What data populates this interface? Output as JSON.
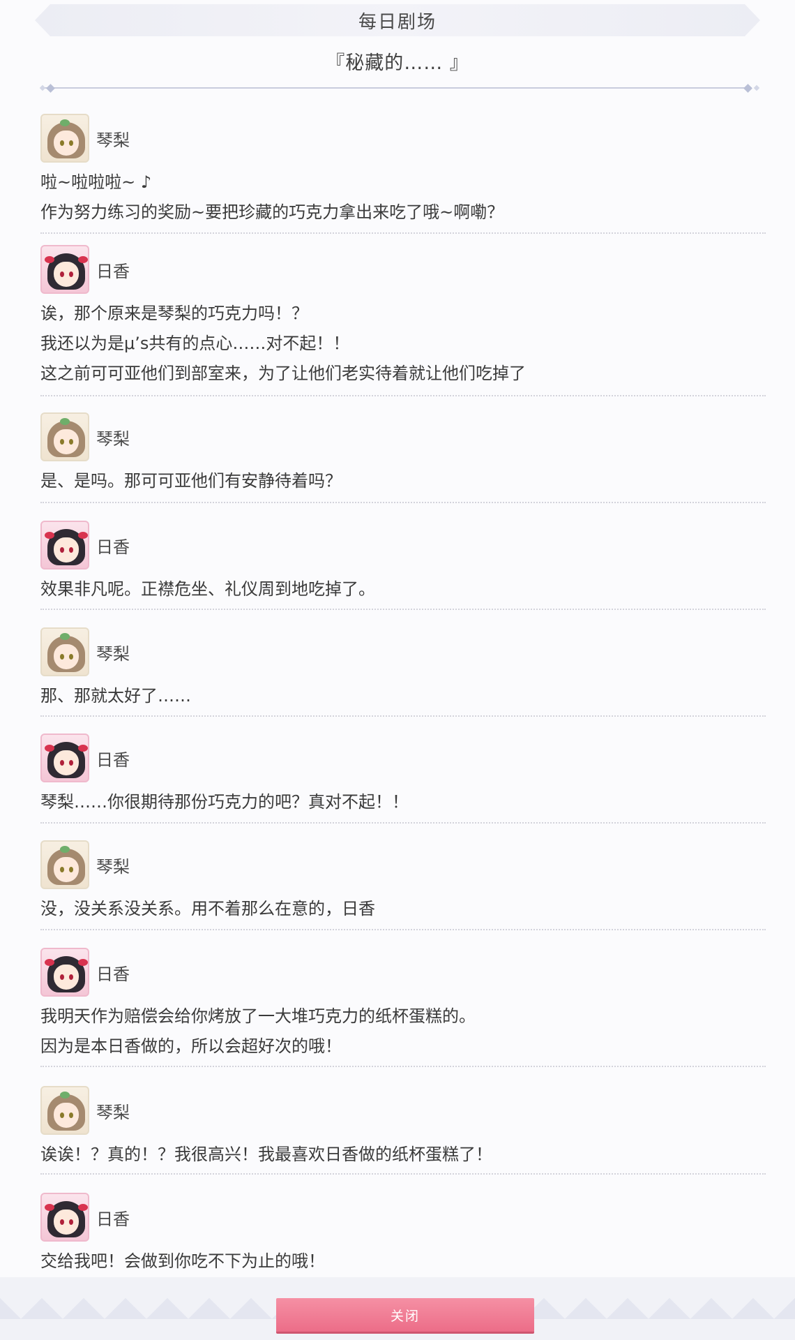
{
  "header": {
    "title": "每日剧场",
    "subtitle": "『秘藏的…… 』"
  },
  "dialogue": [
    {
      "speaker": "琴梨",
      "avatar": "kotori-avatar",
      "lines": [
        "啦~啦啦啦~ ♪",
        "作为努力练习的奖励~要把珍藏的巧克力拿出来吃了哦~啊嘞？"
      ]
    },
    {
      "speaker": "日香",
      "avatar": "nico-avatar",
      "lines": [
        "诶，那个原来是琴梨的巧克力吗！？",
        "我还以为是μ’s共有的点心……对不起！！",
        "这之前可可亚他们到部室来，为了让他们老实待着就让他们吃掉了"
      ]
    },
    {
      "speaker": "琴梨",
      "avatar": "kotori-avatar",
      "lines": [
        "是、是吗。那可可亚他们有安静待着吗？"
      ]
    },
    {
      "speaker": "日香",
      "avatar": "nico-avatar",
      "lines": [
        "效果非凡呢。正襟危坐、礼仪周到地吃掉了。"
      ]
    },
    {
      "speaker": "琴梨",
      "avatar": "kotori-avatar",
      "lines": [
        "那、那就太好了……"
      ]
    },
    {
      "speaker": "日香",
      "avatar": "nico-avatar",
      "lines": [
        "琴梨……你很期待那份巧克力的吧？真对不起！！"
      ]
    },
    {
      "speaker": "琴梨",
      "avatar": "kotori-avatar",
      "lines": [
        "没，没关系没关系。用不着那么在意的，日香"
      ]
    },
    {
      "speaker": "日香",
      "avatar": "nico-avatar",
      "lines": [
        "我明天作为赔偿会给你烤放了一大堆巧克力的纸杯蛋糕的。",
        "因为是本日香做的，所以会超好次的哦！"
      ]
    },
    {
      "speaker": "琴梨",
      "avatar": "kotori-avatar",
      "lines": [
        "诶诶！？真的！？我很高兴！我最喜欢日香做的纸杯蛋糕了！"
      ]
    },
    {
      "speaker": "日香",
      "avatar": "nico-avatar",
      "lines": [
        "交给我吧！会做到你吃不下为止的哦！"
      ]
    }
  ],
  "footer": {
    "close_label": "关闭"
  }
}
